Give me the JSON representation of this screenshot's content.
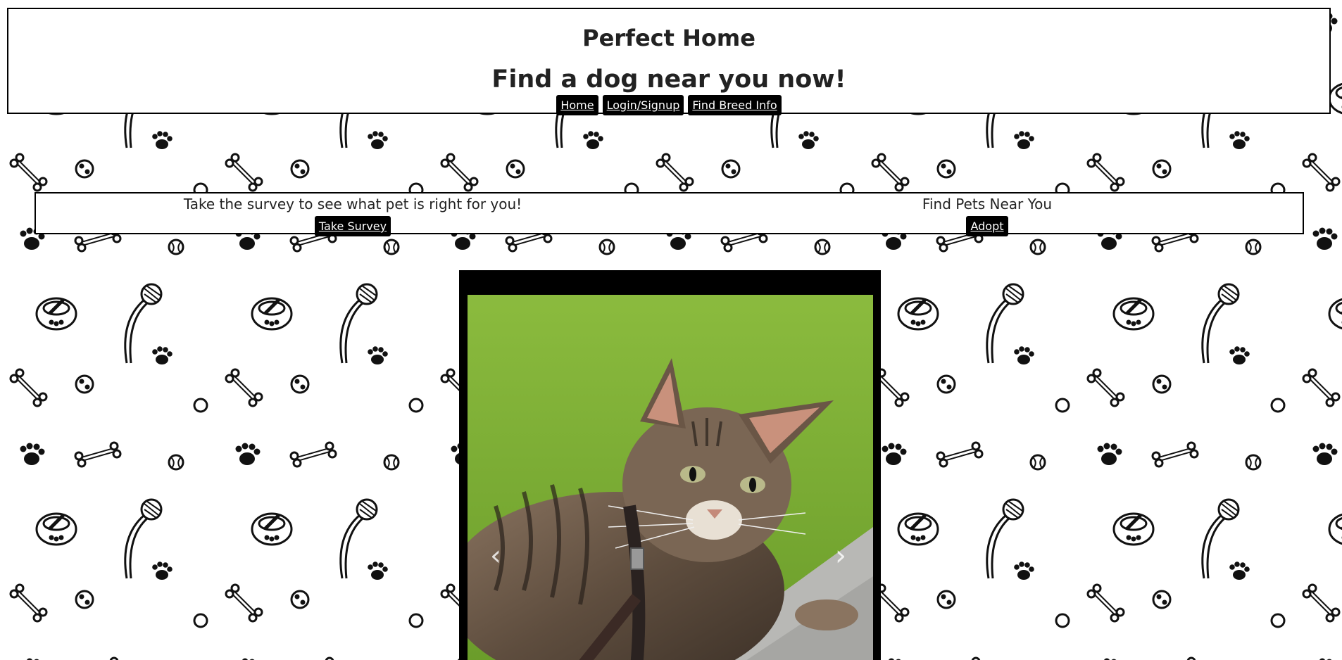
{
  "header": {
    "title": "Perfect Home",
    "subtitle": "Find a dog near you now!",
    "nav": [
      "Home",
      "Login/Signup",
      "Find Breed Info"
    ]
  },
  "cta": {
    "survey_text": "Take the survey to see what pet is right for you!",
    "survey_button": "Take Survey",
    "adopt_text": "Find Pets Near You",
    "adopt_button": "Adopt"
  },
  "carousel": {
    "prev_label": "‹",
    "next_label": "›"
  },
  "icons": {
    "background": "pet-pattern-background",
    "prev": "chevron-left-icon",
    "next": "chevron-right-icon"
  },
  "colors": {
    "button_bg": "#000000",
    "button_text": "#ffffff",
    "panel_border": "#000000"
  }
}
